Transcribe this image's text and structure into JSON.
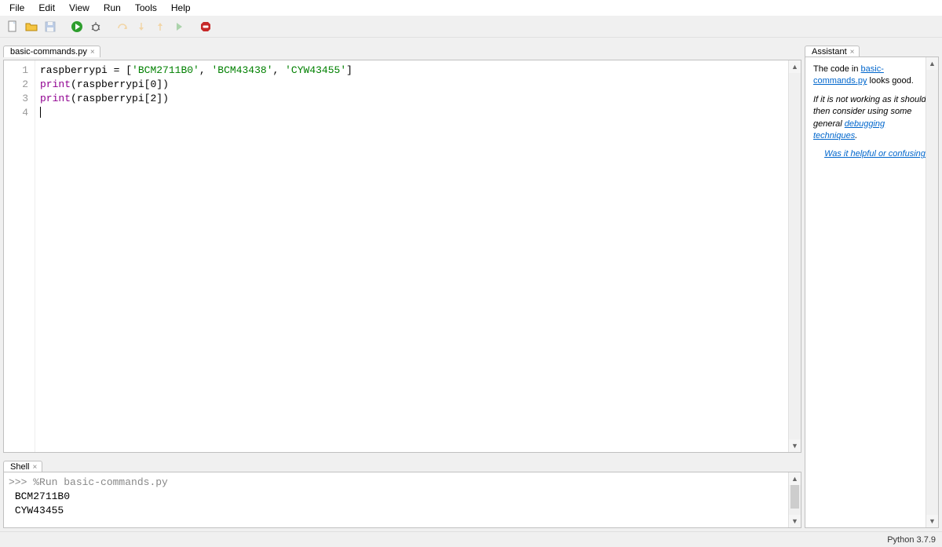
{
  "menu": {
    "items": [
      "File",
      "Edit",
      "View",
      "Run",
      "Tools",
      "Help"
    ]
  },
  "toolbar": {
    "new": "New",
    "open": "Open",
    "save": "Save",
    "run": "Run",
    "debug": "Debug",
    "step_over": "Step over",
    "step_into": "Step into",
    "step_out": "Step out",
    "resume": "Resume",
    "stop": "Stop"
  },
  "editor": {
    "tab_label": "basic-commands.py",
    "line_numbers": [
      "1",
      "2",
      "3",
      "4"
    ],
    "code": {
      "l1": {
        "id": "raspberrypi",
        "eq": " = [",
        "s1": "'BCM2711B0'",
        "c1": ", ",
        "s2": "'BCM43438'",
        "c2": ", ",
        "s3": "'CYW43455'",
        "end": "]"
      },
      "l2": {
        "fn": "print",
        "open": "(",
        "id": "raspberrypi",
        "br": "[",
        "n": "0",
        "close": "])"
      },
      "l3": {
        "fn": "print",
        "open": "(",
        "id": "raspberrypi",
        "br": "[",
        "n": "2",
        "close": "])"
      }
    }
  },
  "shell": {
    "tab_label": "Shell",
    "prompt": ">>> ",
    "run_cmd": "%Run basic-commands.py",
    "output": [
      "BCM2711B0",
      "CYW43455"
    ]
  },
  "assistant": {
    "tab_label": "Assistant",
    "p1_a": "The code in ",
    "p1_link": "basic-commands.py",
    "p1_b": " looks good.",
    "p2_a": "If it is not working as it should, then consider using some general ",
    "p2_link": "debugging techniques",
    "p2_b": ".",
    "feedback": "Was it helpful or confusing?"
  },
  "status": {
    "python": "Python 3.7.9"
  }
}
